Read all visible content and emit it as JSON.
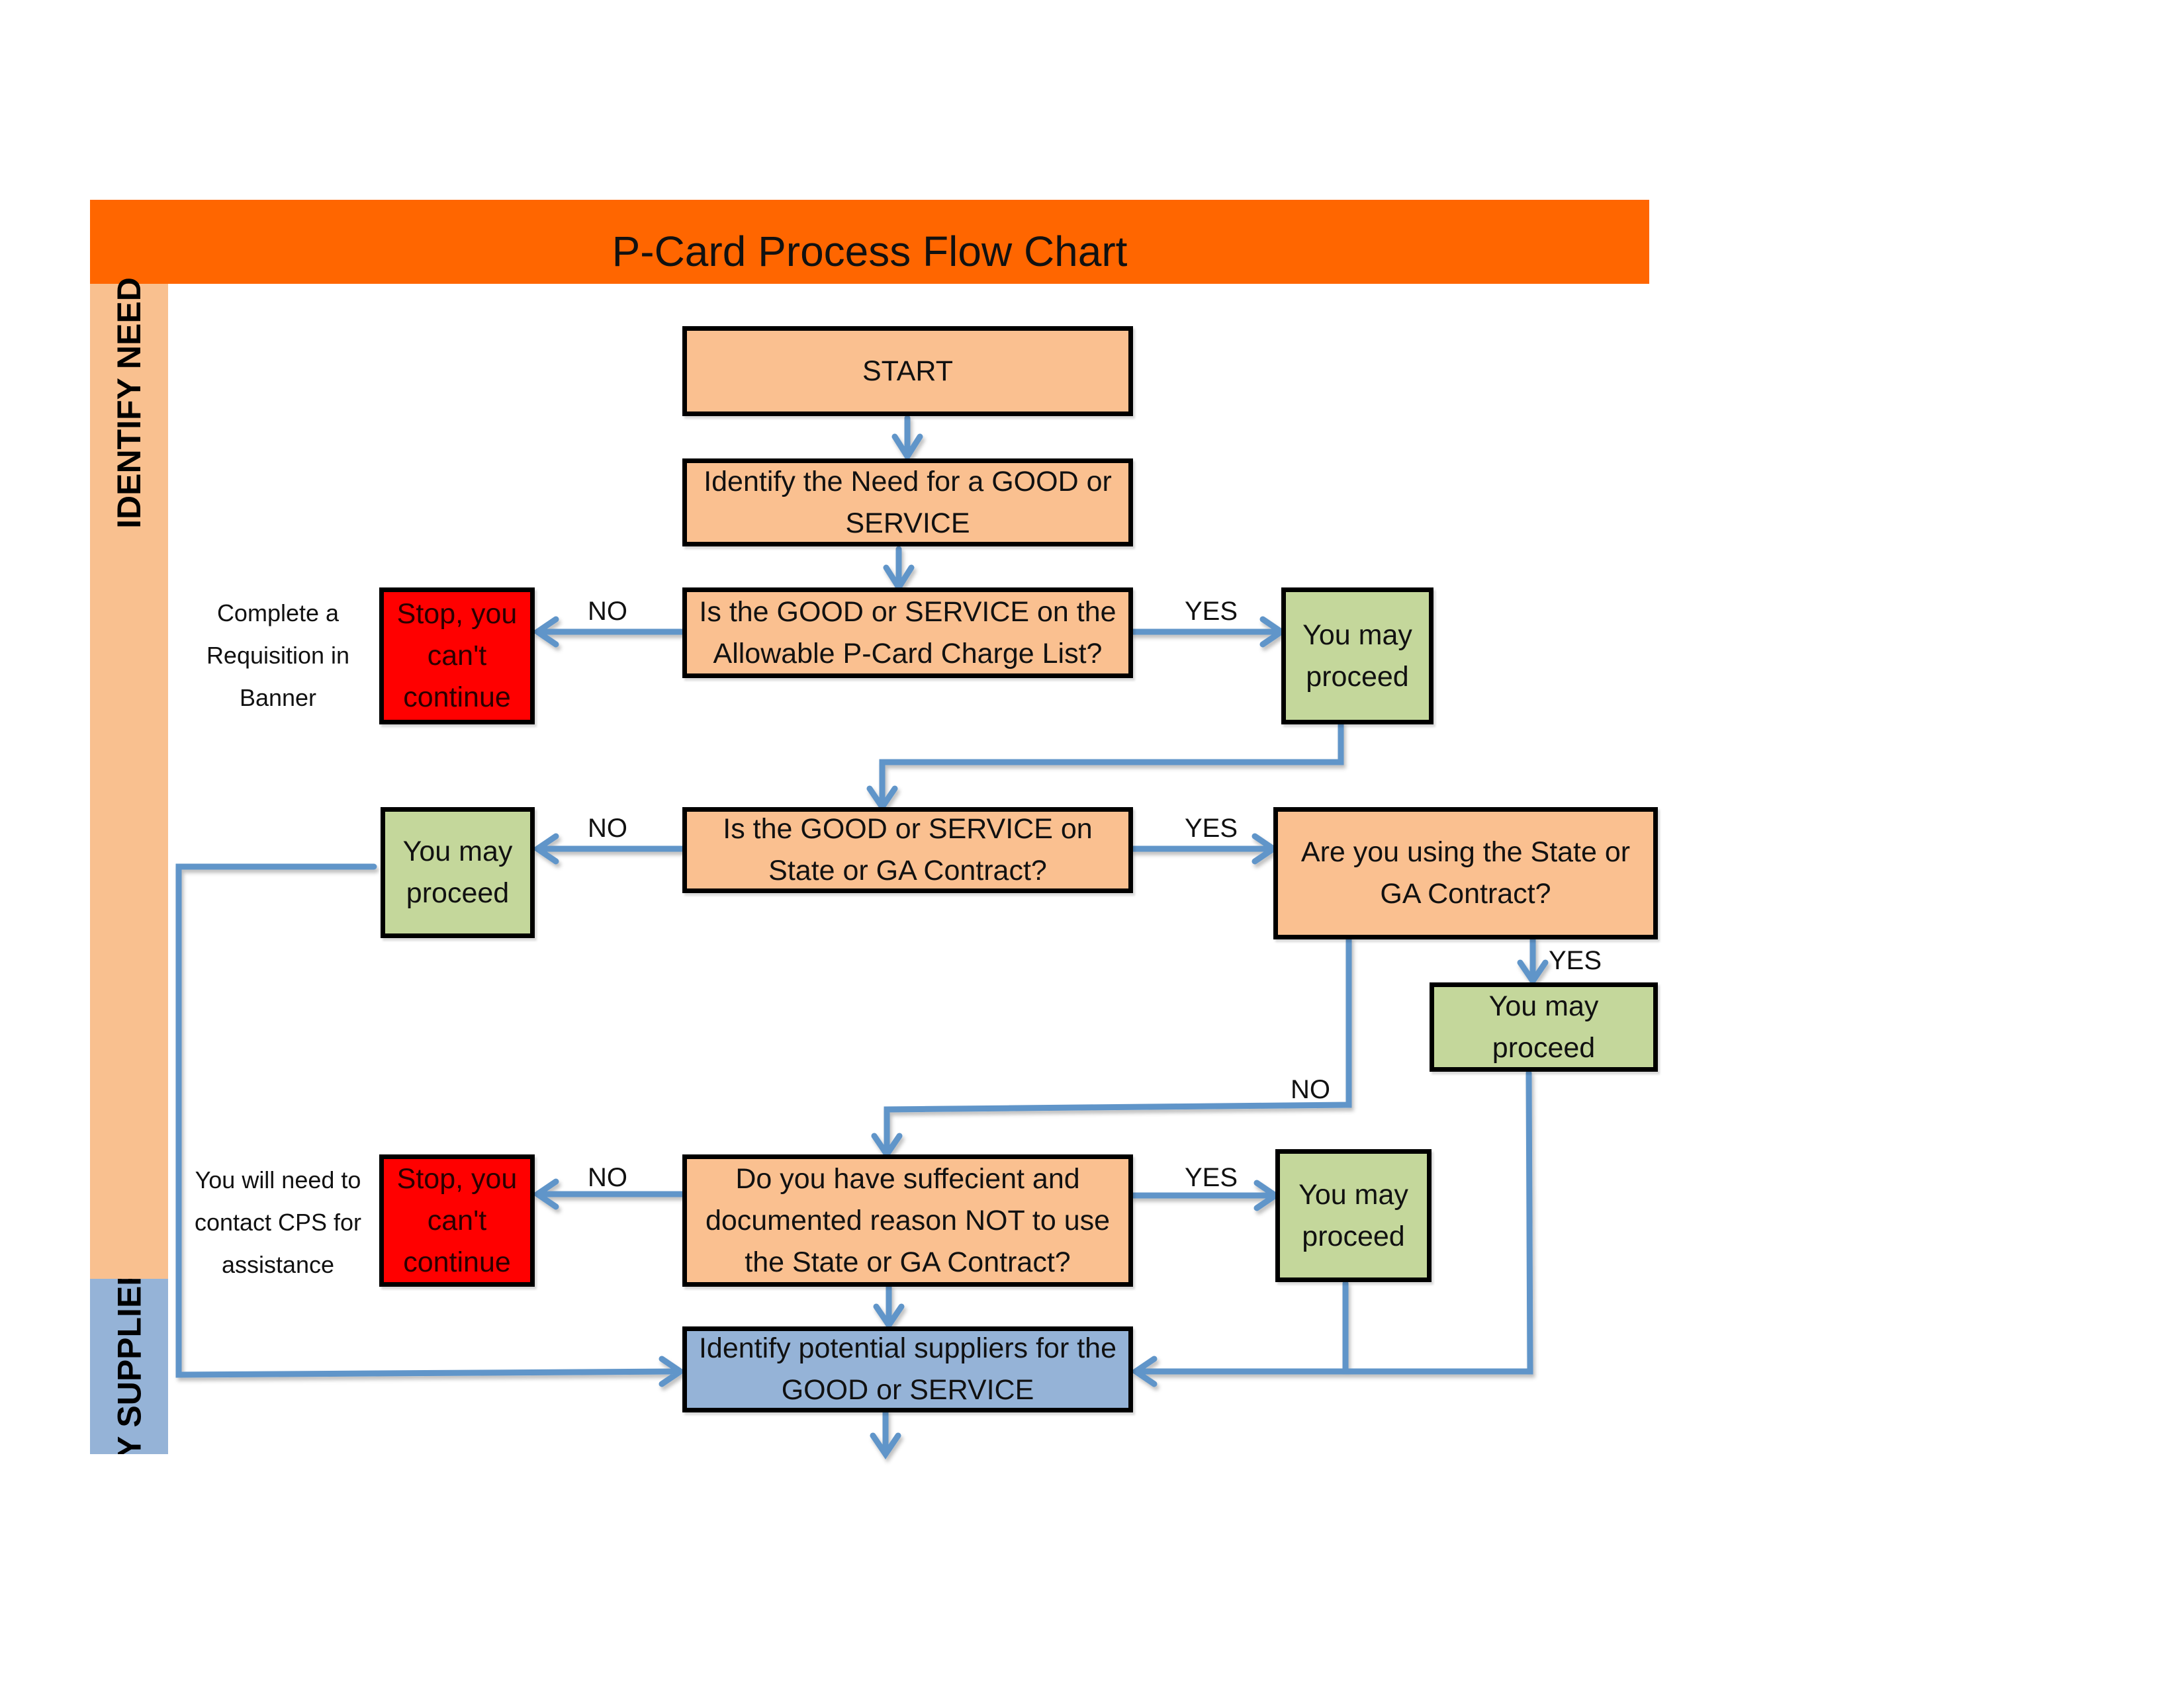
{
  "header": {
    "title": "P-Card Process Flow Chart",
    "color": "#ff6600"
  },
  "sidebar": {
    "sections": [
      {
        "label": "IDENTIFY NEED",
        "color": "#f9c08f"
      },
      {
        "label": "IDENTIFY SUPPLIER",
        "color": "#95b3d7"
      }
    ]
  },
  "nodes": {
    "start": "START",
    "identify_need": "Identify the Need for a GOOD or SERVICE",
    "q_allowable": "Is the GOOD or SERVICE on the Allowable P-Card Charge List?",
    "stop_1": "Stop, you can't continue",
    "proceed_1": "You may proceed",
    "q_contract": "Is the GOOD or SERVICE on State or GA Contract?",
    "proceed_2": "You may proceed",
    "q_using_contract": "Are you using the State or GA Contract?",
    "proceed_3": "You may proceed",
    "q_reason": "Do you have suffecient and documented reason NOT to use the State or GA Contract?",
    "stop_2": "Stop, you can't continue",
    "proceed_4": "You may proceed",
    "identify_suppliers": "Identify potential suppliers for the GOOD or SERVICE"
  },
  "notes": {
    "requisition": "Complete a Requisition in Banner",
    "contact_cps": "You will need to contact CPS for assistance"
  },
  "edge_labels": {
    "no_1": "NO",
    "yes_1": "YES",
    "no_2": "NO",
    "yes_2": "YES",
    "yes_3": "YES",
    "no_3": "NO",
    "no_4": "NO",
    "yes_4": "YES"
  },
  "colors": {
    "process": "#fac090",
    "proceed": "#c4d79b",
    "stop": "#ff0000",
    "supplier": "#95b3d7",
    "connector": "#6195c9"
  }
}
